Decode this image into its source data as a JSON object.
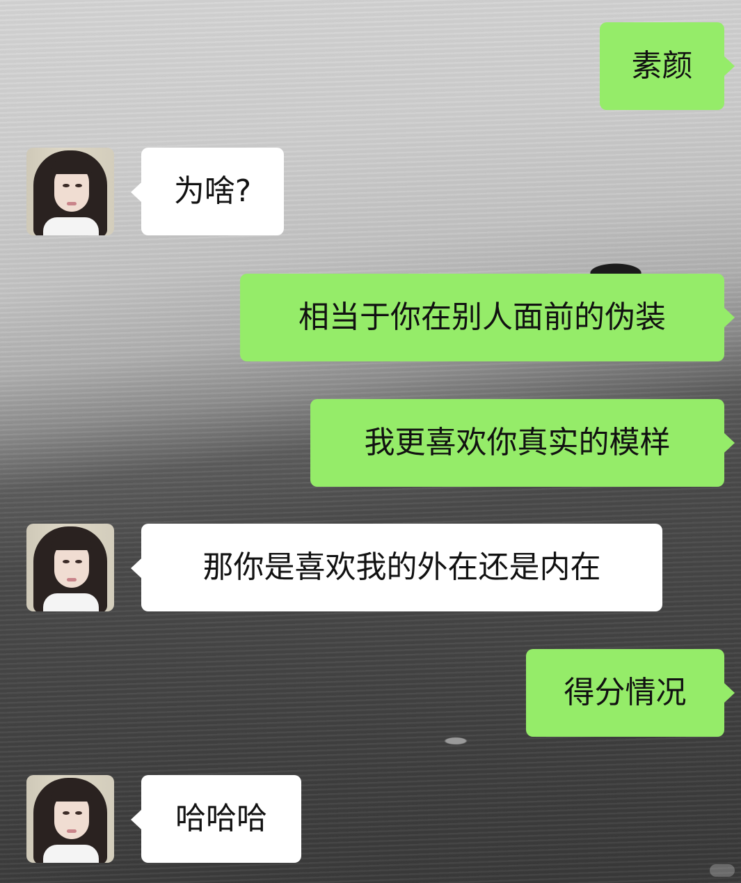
{
  "chat": {
    "messages": [
      {
        "side": "right",
        "text": "素颜"
      },
      {
        "side": "left",
        "text": "为啥?"
      },
      {
        "side": "right",
        "text": "相当于你在别人面前的伪装"
      },
      {
        "side": "right",
        "text": "我更喜欢你真实的模样"
      },
      {
        "side": "left",
        "text": "那你是喜欢我的外在还是内在"
      },
      {
        "side": "right",
        "text": "得分情况"
      },
      {
        "side": "left",
        "text": "哈哈哈"
      }
    ]
  },
  "colors": {
    "outgoing_bubble": "#95ec69",
    "incoming_bubble": "#ffffff",
    "text": "#111111"
  },
  "icons": {
    "contact_avatar": "avatar-photo-icon"
  }
}
